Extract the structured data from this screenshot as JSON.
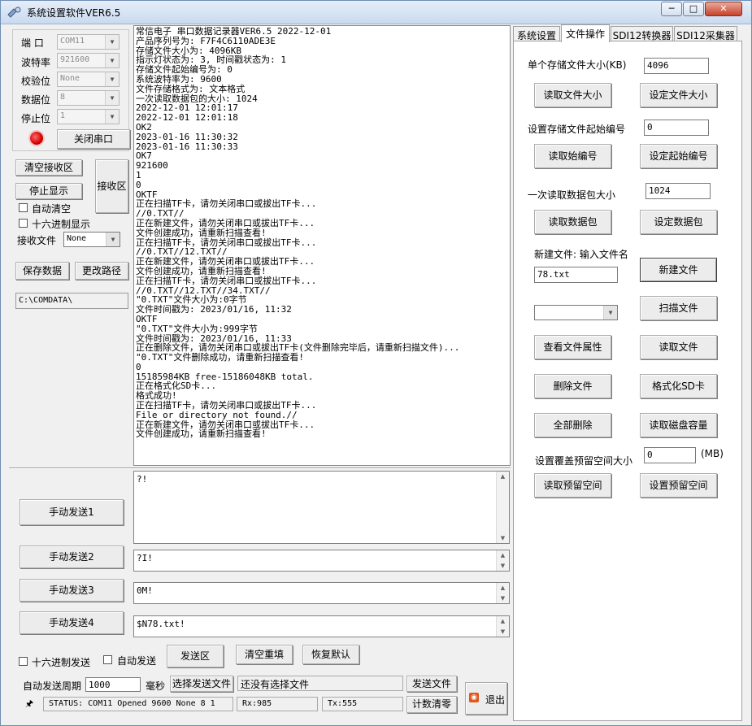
{
  "window": {
    "title": "系统设置软件VER6.5",
    "buttons": {
      "minimize": "─",
      "maximize": "□",
      "close": "✕"
    }
  },
  "port": {
    "port_label": "端  口",
    "port_value": "COM11",
    "baud_label": "波特率",
    "baud_value": "921600",
    "parity_label": "校验位",
    "parity_value": "None",
    "databits_label": "数据位",
    "databits_value": "8",
    "stopbits_label": "停止位",
    "stopbits_value": "1",
    "close_port_button": "关闭串口"
  },
  "receive": {
    "clear_button": "清空接收区",
    "stop_display_button": "停止显示",
    "receive_area_button": "接收区",
    "auto_clear_label": "自动清空",
    "hex_display_label": "十六进制显示",
    "file_label": "接收文件",
    "file_value": "None",
    "save_button": "保存数据",
    "change_path_button": "更改路径",
    "path": "C:\\COMDATA\\"
  },
  "log": [
    "常信电子 串口数据记录器VER6.5 2022-12-01",
    "产品序列号为: F7F4C6110ADE3E",
    "存储文件大小为: 4096KB",
    "指示灯状态为: 3, 时间戳状态为: 1",
    "存储文件起始编号为: 0",
    "系统波特率为: 9600",
    "文件存储格式为: 文本格式",
    "一次读取数据包的大小: 1024",
    "2022-12-01 12:01:17",
    "2022-12-01 12:01:18",
    "OK2",
    "2023-01-16 11:30:32",
    "2023-01-16 11:30:33",
    "OK7",
    "921600",
    "1",
    "0",
    "OKTF",
    "正在扫描TF卡，请勿关闭串口或拔出TF卡...",
    "//0.TXT//",
    "正在新建文件，请勿关闭串口或拔出TF卡...",
    "文件创建成功，请重新扫描查看!",
    "正在扫描TF卡，请勿关闭串口或拔出TF卡...",
    "//0.TXT//12.TXT//",
    "正在新建文件，请勿关闭串口或拔出TF卡...",
    "文件创建成功，请重新扫描查看!",
    "正在扫描TF卡，请勿关闭串口或拔出TF卡...",
    "//0.TXT//12.TXT//34.TXT//",
    "\"0.TXT\"文件大小为:0字节",
    "文件时间戳为: 2023/01/16, 11:32",
    "OKTF",
    "\"0.TXT\"文件大小为:999字节",
    "文件时间戳为: 2023/01/16, 11:33",
    "正在删除文件，请勿关闭串口或拔出TF卡(文件删除完毕后，请重新扫描文件)...",
    "\"0.TXT\"文件删除成功，请重新扫描查看!",
    "0",
    "15185984KB free-15186048KB total.",
    "正在格式化SD卡...",
    "格式成功!",
    "正在扫描TF卡，请勿关闭串口或拔出TF卡...",
    "File or directory not found.//",
    "正在新建文件，请勿关闭串口或拔出TF卡...",
    "文件创建成功，请重新扫描查看!"
  ],
  "send": {
    "manual1_button": "手动发送1",
    "manual1_value": "?!",
    "manual2_button": "手动发送2",
    "manual2_value": "?I!",
    "manual3_button": "手动发送3",
    "manual3_value": "0M!",
    "manual4_button": "手动发送4",
    "manual4_value": "$N78.txt!",
    "hex_send_label": "十六进制发送",
    "auto_send_label": "自动发送",
    "send_area_button": "发送区",
    "clear_fill_button": "清空重填",
    "restore_default_button": "恢复默认",
    "period_label": "自动发送周期",
    "period_value": "1000",
    "ms_label": "毫秒",
    "choose_file_button": "选择发送文件",
    "file_status": "还没有选择文件",
    "send_file_button": "发送文件",
    "exit_button": "退出",
    "reset_count_button": "计数清零"
  },
  "status": {
    "status_text": "STATUS: COM11 Opened 9600 None 8 1",
    "rx_text": "Rx:985",
    "tx_text": "Tx:555"
  },
  "tabs": [
    "系统设置",
    "文件操作",
    "SDI12转换器",
    "SDI12采集器"
  ],
  "file_ops": {
    "file_size_label": "单个存储文件大小(KB)",
    "file_size_value": "4096",
    "read_size_button": "读取文件大小",
    "set_size_button": "设定文件大小",
    "start_no_label": "设置存储文件起始编号",
    "start_no_value": "0",
    "read_start_button": "读取始编号",
    "set_start_button": "设定起始编号",
    "packet_label": "一次读取数据包大小",
    "packet_value": "1024",
    "read_packet_button": "读取数据包",
    "set_packet_button": "设定数据包",
    "new_file_label": "新建文件: 输入文件名",
    "new_file_value": "78.txt",
    "new_file_button": "新建文件",
    "file_select_value": "",
    "scan_button": "扫描文件",
    "props_button": "查看文件属性",
    "read_file_button": "读取文件",
    "delete_button": "删除文件",
    "format_button": "格式化SD卡",
    "delete_all_button": "全部删除",
    "disk_capacity_button": "读取磁盘容量",
    "reserve_label": "设置覆盖预留空间大小",
    "reserve_value": "0",
    "reserve_unit": "(MB)",
    "read_reserve_button": "读取预留空间",
    "set_reserve_button": "设置预留空间"
  }
}
